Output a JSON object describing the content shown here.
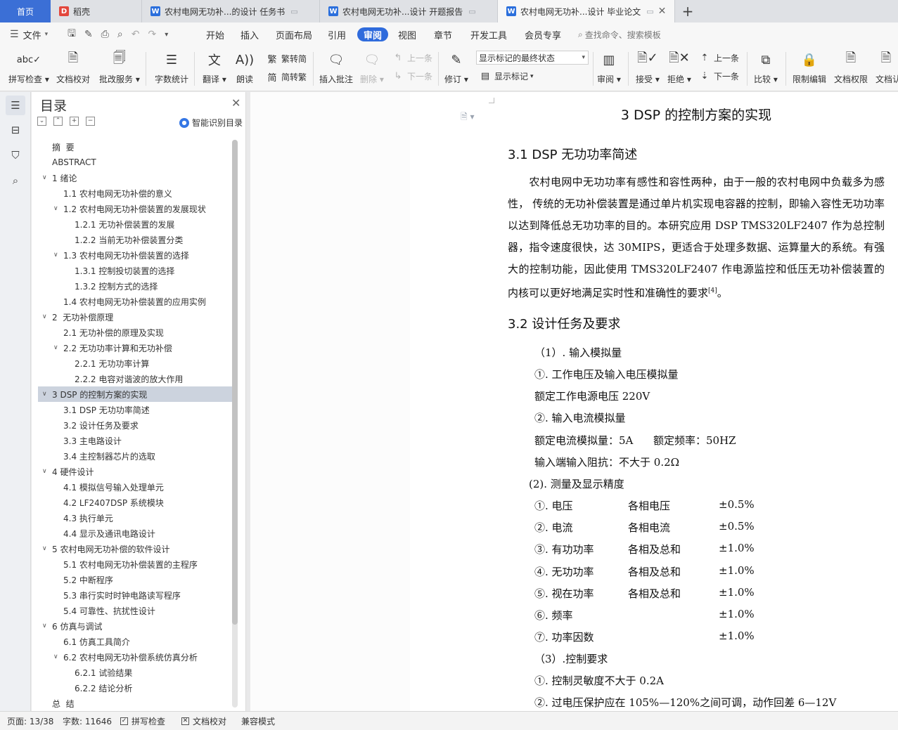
{
  "tabs": {
    "home": "首页",
    "docs": [
      {
        "label": "稻壳",
        "icon": "daoke-icon"
      },
      {
        "label": "农村电网无功补...的设计 任务书",
        "icon": "wps-writer-icon"
      },
      {
        "label": "农村电网无功补...设计 开题报告",
        "icon": "wps-writer-icon"
      },
      {
        "label": "农村电网无功补...设计 毕业论文",
        "icon": "wps-writer-icon"
      }
    ]
  },
  "menubar": {
    "file": "文件",
    "tabs": [
      "开始",
      "插入",
      "页面布局",
      "引用",
      "审阅",
      "视图",
      "章节",
      "开发工具",
      "会员专享"
    ],
    "active_tab": "审阅",
    "search": "查找命令、搜索模板"
  },
  "ribbon": {
    "spell_check": "拼写检查",
    "doc_proof": "文档校对",
    "batch_service": "批改服务",
    "word_count": "字数统计",
    "translate": "翻译",
    "read_aloud": "朗读",
    "trad_to_simp": "繁转简",
    "simp_to_trad": "简转繁",
    "insert_comment": "插入批注",
    "delete": "删除",
    "prev_comment": "上一条",
    "next_comment": "下一条",
    "track_changes": "修订",
    "markup_select": "显示标记的最终状态",
    "show_markup": "显示标记",
    "review_pane": "审阅",
    "accept": "接受",
    "reject": "拒绝",
    "prev_change": "上一条",
    "next_change": "下一条",
    "compare": "比较",
    "restrict_edit": "限制编辑",
    "doc_permission": "文档权限",
    "doc_cert": "文档认"
  },
  "toc": {
    "title": "目录",
    "smart_toc": "智能识别目录",
    "items": [
      {
        "level": 1,
        "label": "摘  要",
        "caret": ""
      },
      {
        "level": 1,
        "label": "ABSTRACT",
        "caret": ""
      },
      {
        "level": 1,
        "label": "1 绪论",
        "caret": "v"
      },
      {
        "level": 2,
        "label": "1.1 农村电网无功补偿的意义",
        "caret": ""
      },
      {
        "level": 2,
        "label": "1.2 农村电网无功补偿装置的发展现状",
        "caret": "v"
      },
      {
        "level": 3,
        "label": "1.2.1 无功补偿装置的发展",
        "caret": ""
      },
      {
        "level": 3,
        "label": "1.2.2 当前无功补偿装置分类",
        "caret": ""
      },
      {
        "level": 2,
        "label": "1.3 农村电网无功补偿装置的选择",
        "caret": "v"
      },
      {
        "level": 3,
        "label": "1.3.1 控制投切装置的选择",
        "caret": ""
      },
      {
        "level": 3,
        "label": "1.3.2 控制方式的选择",
        "caret": ""
      },
      {
        "level": 2,
        "label": "1.4 农村电网无功补偿装置的应用实例",
        "caret": ""
      },
      {
        "level": 1,
        "label": "2  无功补偿原理",
        "caret": "v"
      },
      {
        "level": 2,
        "label": "2.1 无功补偿的原理及实现",
        "caret": ""
      },
      {
        "level": 2,
        "label": "2.2 无功功率计算和无功补偿",
        "caret": "v"
      },
      {
        "level": 3,
        "label": "2.2.1 无功功率计算",
        "caret": ""
      },
      {
        "level": 3,
        "label": "2.2.2 电容对谐波的放大作用",
        "caret": ""
      },
      {
        "level": 1,
        "label": "3 DSP 的控制方案的实现",
        "caret": "v",
        "selected": true
      },
      {
        "level": 2,
        "label": "3.1 DSP 无功功率简述",
        "caret": ""
      },
      {
        "level": 2,
        "label": "3.2 设计任务及要求",
        "caret": ""
      },
      {
        "level": 2,
        "label": "3.3 主电路设计",
        "caret": ""
      },
      {
        "level": 2,
        "label": "3.4 主控制器芯片的选取",
        "caret": ""
      },
      {
        "level": 1,
        "label": "4 硬件设计",
        "caret": "v"
      },
      {
        "level": 2,
        "label": "4.1 模拟信号输入处理单元",
        "caret": ""
      },
      {
        "level": 2,
        "label": "4.2 LF2407DSP 系统模块",
        "caret": ""
      },
      {
        "level": 2,
        "label": "4.3 执行单元",
        "caret": ""
      },
      {
        "level": 2,
        "label": "4.4 显示及通讯电路设计",
        "caret": ""
      },
      {
        "level": 1,
        "label": "5 农村电网无功补偿的软件设计",
        "caret": "v"
      },
      {
        "level": 2,
        "label": "5.1 农村电网无功补偿装置的主程序",
        "caret": ""
      },
      {
        "level": 2,
        "label": "5.2 中断程序",
        "caret": ""
      },
      {
        "level": 2,
        "label": "5.3 串行实时时钟电路读写程序",
        "caret": ""
      },
      {
        "level": 2,
        "label": "5.4 可靠性、抗扰性设计",
        "caret": ""
      },
      {
        "level": 1,
        "label": "6 仿真与调试",
        "caret": "v"
      },
      {
        "level": 2,
        "label": "6.1 仿真工具简介",
        "caret": ""
      },
      {
        "level": 2,
        "label": "6.2 农村电网无功补偿系统仿真分析",
        "caret": "v"
      },
      {
        "level": 3,
        "label": "6.2.1 试验结果",
        "caret": ""
      },
      {
        "level": 3,
        "label": "6.2.2 结论分析",
        "caret": ""
      },
      {
        "level": 1,
        "label": "总  结",
        "caret": ""
      }
    ]
  },
  "document": {
    "chapter_title": "3 DSP 的控制方案的实现",
    "s31_title": "3.1 DSP 无功功率简述",
    "s31_para_1": "农村电网中无功功率有感性和容性两种，由于一般的农村电网中负载多为感性，  传统的无功补偿装置是通过单片机实现电容器的控制，即输入容性无功功率以达到降低总无功功率的目的。本研究应用 DSP TMS320LF2407 作为总控制器，指令速度很快，达 30MIPS，更适合于处理多数据、运算量大的系统。有强大的控制功能，因此使用 TMS320LF2407 作电源监控和低压无功补偿装置的内核可以更好地满足实时性和准确性的要求",
    "s31_cite": "[4]",
    "s31_para_end": "。",
    "s32_title": "3.2 设计任务及要求",
    "input_title": "（1）. 输入模拟量",
    "input_v_title": "①. 工作电压及输入电压模拟量",
    "input_v_rated": "额定工作电源电压 220V",
    "input_i_title": "②. 输入电流模拟量",
    "input_i_rated": "额定电流模拟量：5A      额定频率：50HZ",
    "input_impedance": "输入端输入阻抗：不大于 0.2Ω",
    "measure_title": "(2).  测量及显示精度",
    "measure_rows": [
      {
        "name": "①. 电压",
        "scope": "各相电压",
        "accuracy": "±0.5%"
      },
      {
        "name": "②. 电流",
        "scope": "各相电流",
        "accuracy": "±0.5%"
      },
      {
        "name": "③. 有功功率",
        "scope": "各相及总和",
        "accuracy": "±1.0%"
      },
      {
        "name": "④. 无功功率",
        "scope": "各相及总和",
        "accuracy": "±1.0%"
      },
      {
        "name": "⑤. 视在功率",
        "scope": "各相及总和",
        "accuracy": "±1.0%"
      },
      {
        "name": "⑥. 频率",
        "scope": "",
        "accuracy": "±1.0%"
      },
      {
        "name": "⑦. 功率因数",
        "scope": "",
        "accuracy": "±1.0%"
      }
    ],
    "control_title": "（3）.控制要求",
    "control_1": "①. 控制灵敏度不大于 0.2A",
    "control_2": "②. 过电压保护应在 105%—120%之间可调，动作回差 6—12V"
  },
  "statusbar": {
    "page": "页面: 13/38",
    "word_count": "字数: 11646",
    "spell_check": "拼写检查",
    "doc_proof": "文档校对",
    "compat_mode": "兼容模式"
  },
  "colors": {
    "accent": "#2f6bdc",
    "home_tab": "#3b6fd6",
    "toc_selected": "#ccd3de"
  }
}
